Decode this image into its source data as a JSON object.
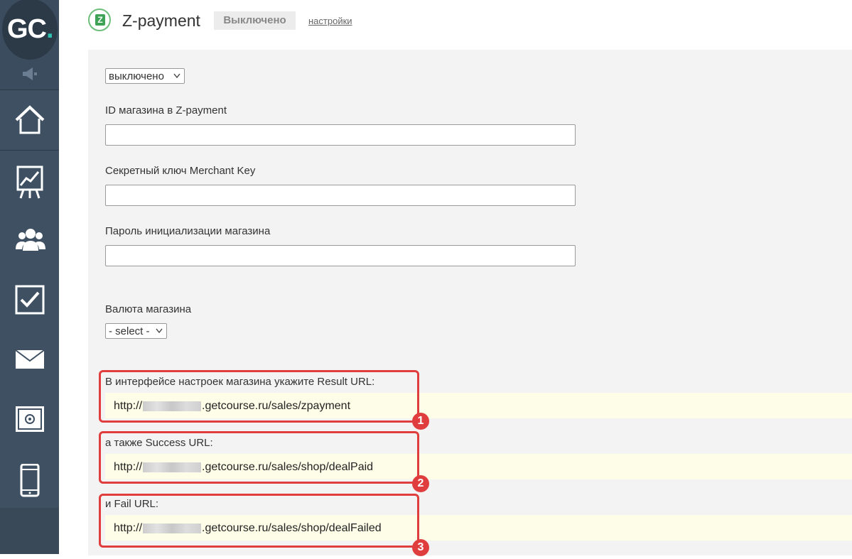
{
  "app": {
    "logo_text": "GC",
    "logo_dot": "."
  },
  "sidebar": {
    "items": [
      {
        "name": "home-icon"
      },
      {
        "name": "chart-icon"
      },
      {
        "name": "users-icon"
      },
      {
        "name": "checkbox-icon"
      },
      {
        "name": "mail-icon"
      },
      {
        "name": "safe-icon"
      },
      {
        "name": "mobile-icon"
      }
    ],
    "announce_icon": "megaphone-icon"
  },
  "header": {
    "title": "Z-payment",
    "status": "Выключено",
    "settings_link": "настройки",
    "logo_letter": "Z"
  },
  "form": {
    "mode_select": "выключено",
    "shop_id_label": "ID магазина в Z-payment",
    "shop_id_value": "",
    "merchant_key_label": "Секретный ключ Merchant Key",
    "merchant_key_value": "",
    "init_password_label": "Пароль инициализации магазина",
    "init_password_value": "",
    "currency_label": "Валюта магазина",
    "currency_select": "- select -"
  },
  "urls": [
    {
      "label": "В интерфейсе настроек магазина укажите Result URL:",
      "prefix": "http://",
      "suffix": ".getcourse.ru/sales/zpayment",
      "marker": "1"
    },
    {
      "label": "а также Success URL:",
      "prefix": "http://",
      "suffix": ".getcourse.ru/sales/shop/dealPaid",
      "marker": "2"
    },
    {
      "label": "и Fail URL:",
      "prefix": "http://",
      "suffix": ".getcourse.ru/sales/shop/dealFailed",
      "marker": "3"
    }
  ],
  "colors": {
    "sidebar": "#3b4c5e",
    "accent": "#2fc0b0",
    "highlight": "#e03e3e",
    "url_background": "#fefee8"
  }
}
